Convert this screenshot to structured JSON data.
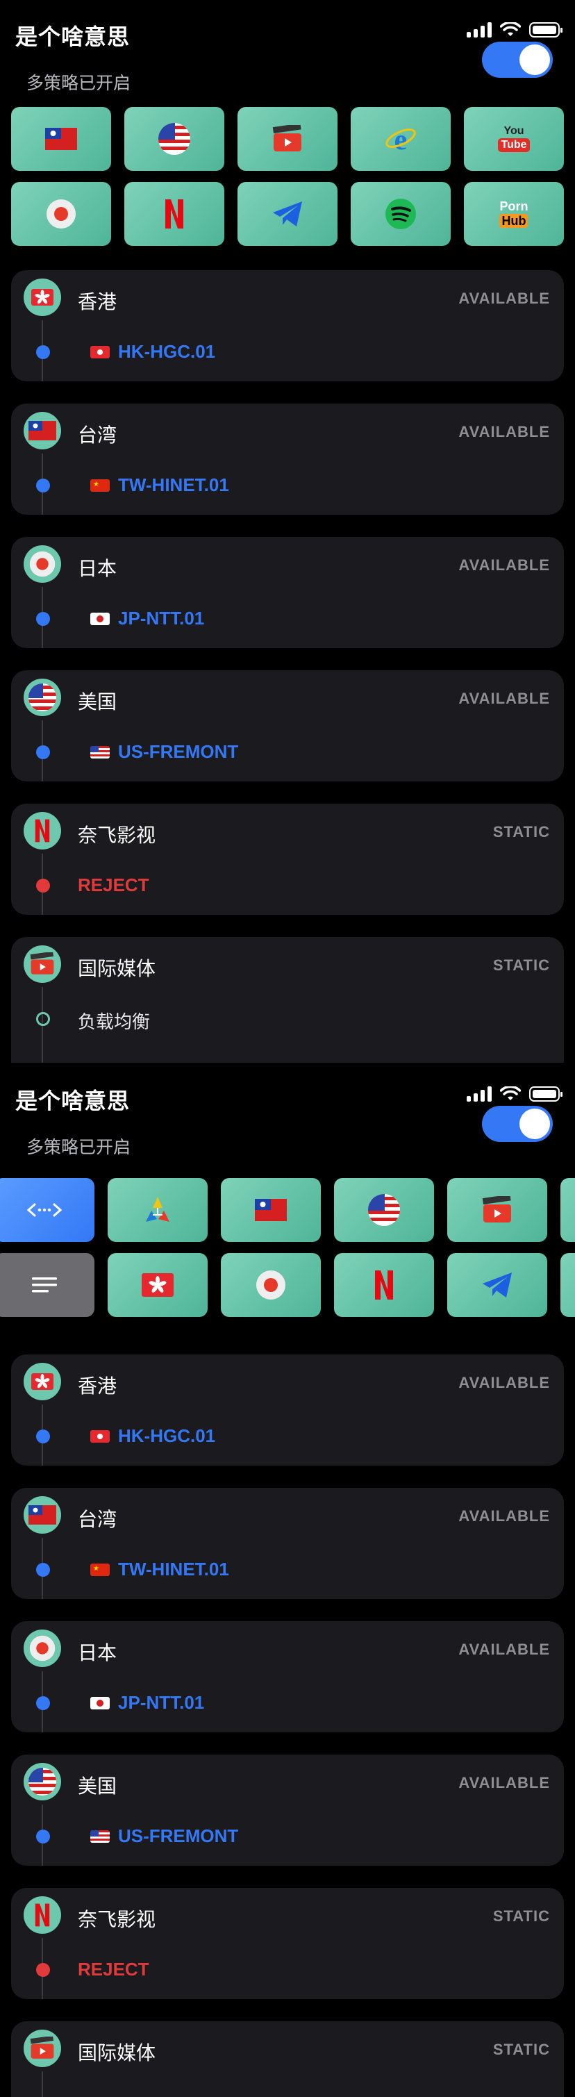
{
  "app": {
    "status_title": "是个啥意思"
  },
  "header": {
    "subtitle": "多策略已开启",
    "toggle_on": true
  },
  "colors": {
    "accent": "#3478f6",
    "tile": "#6ec8ad",
    "reject": "#e03a3a",
    "status": "#8e8e93"
  },
  "screen1_tiles": [
    "taiwan-flag-icon",
    "us-flag-icon",
    "video-clapper-icon",
    "internet-explorer-icon",
    "youtube-icon",
    "record-icon",
    "netflix-icon",
    "telegram-icon",
    "spotify-icon",
    "pornhub-icon"
  ],
  "youtube_tile": {
    "top": "You",
    "bottom": "Tube"
  },
  "pornhub_tile": {
    "top": "Porn",
    "bottom": "Hub"
  },
  "screen2_tiles": [
    "code-icon",
    "proxy-icon",
    "taiwan-flag-icon",
    "us-flag-icon",
    "video-clapper-icon",
    "list-icon",
    "hongkong-flag-icon",
    "record-icon",
    "netflix-icon",
    "telegram-icon"
  ],
  "cards": [
    {
      "name": "香港",
      "status": "AVAILABLE",
      "selected": "HK-HGC.01",
      "badge": "hongkong-flag-icon",
      "flag": "hk"
    },
    {
      "name": "台湾",
      "status": "AVAILABLE",
      "selected": "TW-HINET.01",
      "badge": "taiwan-flag-icon",
      "flag": "cn"
    },
    {
      "name": "日本",
      "status": "AVAILABLE",
      "selected": "JP-NTT.01",
      "badge": "record-icon",
      "flag": "jp"
    },
    {
      "name": "美国",
      "status": "AVAILABLE",
      "selected": "US-FREMONT",
      "badge": "us-flag-icon",
      "flag": "us"
    },
    {
      "name": "奈飞影视",
      "status": "STATIC",
      "selected": "REJECT",
      "badge": "netflix-icon",
      "flag": ""
    },
    {
      "name": "国际媒体",
      "status": "STATIC",
      "selected": "负载均衡",
      "badge": "video-clapper-icon",
      "flag": ""
    }
  ]
}
